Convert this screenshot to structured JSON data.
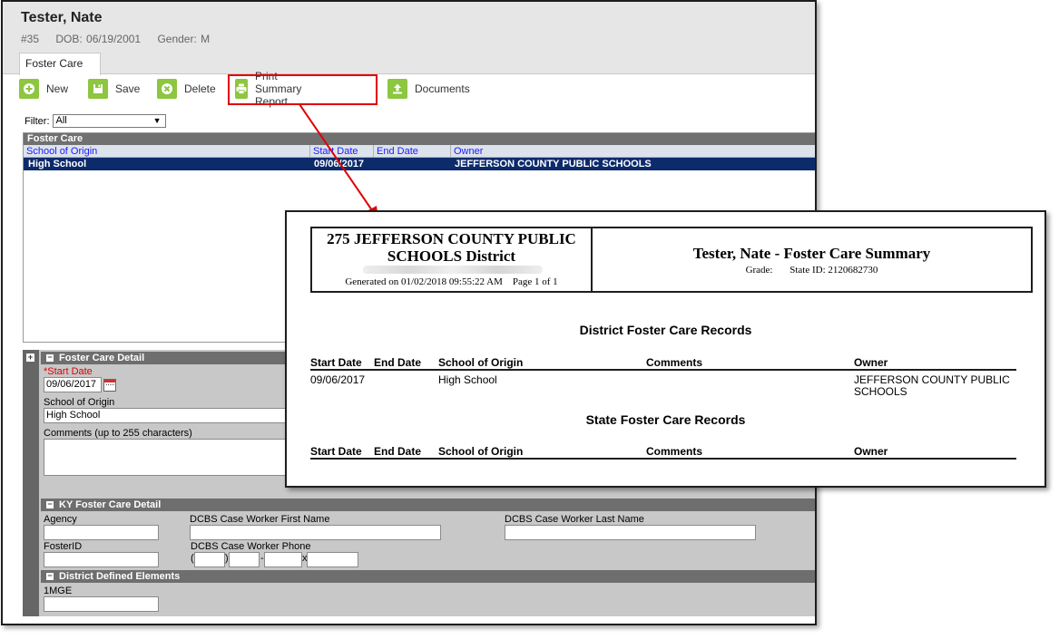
{
  "student": {
    "name": "Tester, Nate",
    "number": "#35",
    "dob": "DOB: 06/19/2001",
    "gender": "Gender: M"
  },
  "tab": {
    "label": "Foster Care"
  },
  "toolbar": {
    "new_label": "New",
    "save_label": "Save",
    "delete_label": "Delete",
    "print_label": "Print Summary Report",
    "documents_label": "Documents"
  },
  "filter": {
    "label": "Filter:",
    "value": "All"
  },
  "grid": {
    "title": "Foster Care",
    "columns": [
      "School of Origin",
      "Start Date",
      "End Date",
      "Owner"
    ],
    "rows": [
      {
        "school": "High School",
        "start": "09/06/2017",
        "end": "",
        "owner": "JEFFERSON COUNTY PUBLIC SCHOOLS"
      }
    ]
  },
  "detail": {
    "section_title": "Foster Care Detail",
    "start_date_label": "Start Date",
    "start_date_value": "09/06/2017",
    "school_label": "School of Origin",
    "school_value": "High School",
    "comments_label": "Comments (up to 255 characters)"
  },
  "ky": {
    "section_title": "KY Foster Care Detail",
    "agency_label": "Agency",
    "worker_first_label": "DCBS Case Worker First Name",
    "worker_last_label": "DCBS Case Worker Last Name",
    "fosterid_label": "FosterID",
    "worker_phone_label": "DCBS Case Worker Phone",
    "phone_open": "(",
    "phone_close": ")",
    "phone_dash": "-",
    "phone_ext": "x"
  },
  "district_elements": {
    "section_title": "District Defined Elements",
    "mge_label": "1MGE"
  },
  "report": {
    "district_line1": "275 JEFFERSON COUNTY PUBLIC",
    "district_line2": "SCHOOLS District",
    "generated": "Generated on 01/02/2018 09:55:22 AM",
    "page": "Page 1 of 1",
    "title": "Tester, Nate - Foster Care Summary",
    "grade_label": "Grade:",
    "state_id": "State ID: 2120682730",
    "district_section": "District Foster Care Records",
    "state_section": "State Foster Care Records",
    "columns": [
      "Start Date",
      "End Date",
      "School of Origin",
      "Comments",
      "Owner"
    ],
    "district_rows": [
      {
        "start": "09/06/2017",
        "end": "",
        "school": "High School",
        "comments": "",
        "owner_line1": "JEFFERSON COUNTY PUBLIC",
        "owner_line2": "SCHOOLS"
      }
    ]
  },
  "colors": {
    "accent_red": "#e00000",
    "selected_row": "#0c2b6b",
    "button_green": "#8dc63f"
  }
}
